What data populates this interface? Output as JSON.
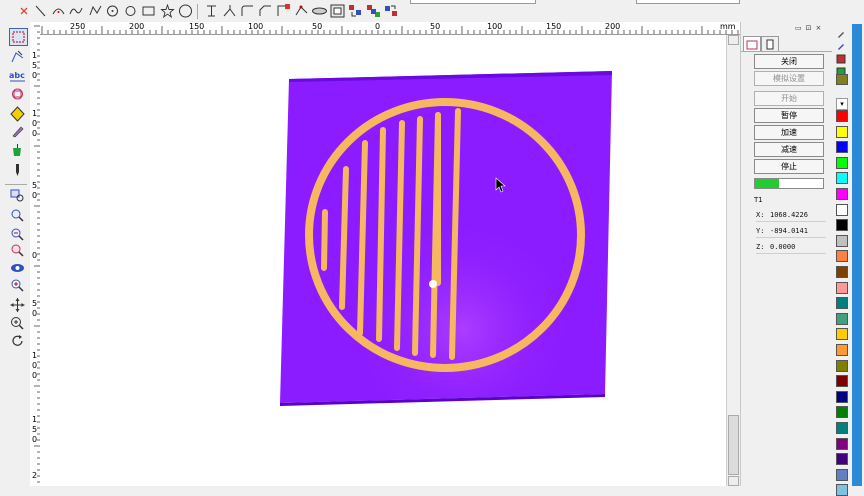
{
  "toolbar": {
    "icons": [
      "close-x-icon",
      "line-icon",
      "arc-icon",
      "curve-icon",
      "polyline-icon",
      "circle-dot-icon",
      "rectangle-icon",
      "star-icon",
      "circle-icon",
      "trim-icon",
      "extend-icon",
      "fillet-icon",
      "chamfer-icon",
      "break-icon",
      "ellipse-icon",
      "group-icon",
      "array-icon",
      "mirror-icon"
    ]
  },
  "ruler": {
    "h_labels": [
      "250",
      "200",
      "150",
      "100",
      "50",
      "0",
      "50",
      "100",
      "150",
      "200"
    ],
    "unit": "mm",
    "v_labels": [
      {
        "top": "1",
        "mid": "5",
        "bot": "0"
      },
      {
        "top": "1",
        "mid": "0",
        "bot": "0"
      },
      {
        "top": "5",
        "mid": "0",
        "bot": ""
      },
      {
        "top": "0",
        "mid": "",
        "bot": ""
      },
      {
        "top": "5",
        "mid": "0",
        "bot": ""
      },
      {
        "top": "1",
        "mid": "0",
        "bot": "0"
      },
      {
        "top": "1",
        "mid": "5",
        "bot": "0"
      },
      {
        "top": "2",
        "mid": "",
        "bot": ""
      }
    ]
  },
  "sim_panel": {
    "tabs": [
      "dashboard-tab-icon",
      "document-tab-icon"
    ],
    "buttons": [
      {
        "label": "关闭",
        "enabled": true
      },
      {
        "label": "模拟设置",
        "enabled": false
      },
      {
        "label": "开始",
        "enabled": false
      },
      {
        "label": "暂停",
        "enabled": true
      },
      {
        "label": "加速",
        "enabled": true
      },
      {
        "label": "减速",
        "enabled": true
      },
      {
        "label": "停止",
        "enabled": true
      }
    ],
    "progress": 0.35,
    "tool": "T1",
    "coords": [
      {
        "label": "X:",
        "value": "1068.4226"
      },
      {
        "label": "Y:",
        "value": "-894.0141"
      },
      {
        "label": "Z:",
        "value": "0.0000"
      }
    ]
  },
  "palette": {
    "colors": [
      "#ff0000",
      "#ffff00",
      "#0000ff",
      "#00ff00",
      "#00ffff",
      "#ff00ff",
      "#ffffff",
      "#000000",
      "#c0c0c0",
      "#ff8040",
      "#804000",
      "#ff9999",
      "#008080",
      "#40a080",
      "#ffcc00",
      "#ff9933",
      "#808000",
      "#800000",
      "#000080",
      "#008000",
      "#008080",
      "#800080",
      "#400080",
      "#6080c0",
      "#80c0e0"
    ]
  },
  "colors": {
    "board": "#8a1cff",
    "trace": "#f5b860",
    "panel_bg": "#f0f0f0",
    "progress": "#22cc33"
  }
}
